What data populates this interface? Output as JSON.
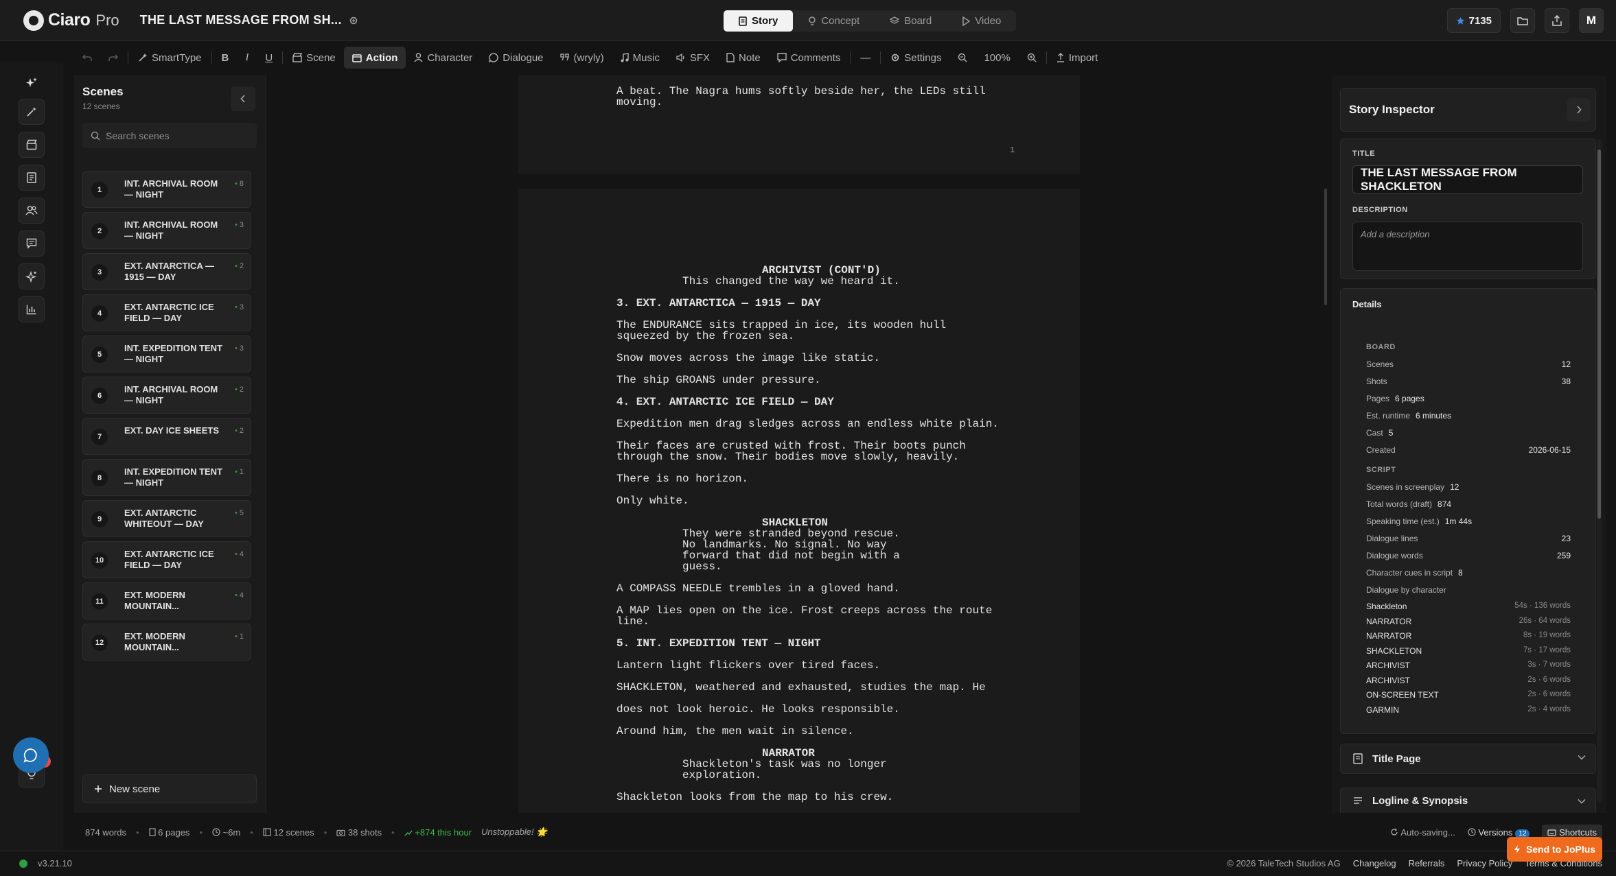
{
  "app": {
    "brand": "Ciaro",
    "brand_suffix": "Pro",
    "doc_title": "THE LAST MESSAGE FROM SH...",
    "modes": [
      {
        "label": "Story",
        "icon": "document-icon"
      },
      {
        "label": "Concept",
        "icon": "bulb-icon"
      },
      {
        "label": "Board",
        "icon": "layers-icon"
      },
      {
        "label": "Video",
        "icon": "play-icon"
      }
    ],
    "active_mode": "Story",
    "credits": "7135",
    "avatar": "M"
  },
  "toolbar": {
    "items": [
      {
        "label": "SmartType",
        "icon": "magic-wand-icon"
      },
      {
        "label": "B",
        "icon": ""
      },
      {
        "label": "I",
        "icon": ""
      },
      {
        "label": "U",
        "icon": ""
      },
      {
        "label": "Scene",
        "icon": "clapper-icon"
      },
      {
        "label": "Action",
        "icon": "action-icon"
      },
      {
        "label": "Character",
        "icon": "person-icon"
      },
      {
        "label": "Dialogue",
        "icon": "bubble-icon"
      },
      {
        "label": "(wryly)",
        "icon": "quote-icon"
      },
      {
        "label": "Music",
        "icon": "music-icon"
      },
      {
        "label": "SFX",
        "icon": "speaker-icon"
      },
      {
        "label": "Note",
        "icon": "note-icon"
      },
      {
        "label": "Comments",
        "icon": "comment-icon"
      },
      {
        "label": "—",
        "icon": ""
      },
      {
        "label": "Settings",
        "icon": "gear-icon"
      },
      {
        "label": "100%",
        "icon": ""
      },
      {
        "label": "Import",
        "icon": "upload-icon"
      }
    ],
    "active": "Action"
  },
  "scenes": {
    "title": "Scenes",
    "count": "12 scenes",
    "search_placeholder": "Search scenes",
    "items": [
      {
        "num": "1",
        "name": "INT. ARCHIVAL ROOM — NIGHT",
        "shots": "8"
      },
      {
        "num": "2",
        "name": "INT. ARCHIVAL ROOM — NIGHT",
        "shots": "3"
      },
      {
        "num": "3",
        "name": "EXT. ANTARCTICA — 1915 — DAY",
        "shots": "2"
      },
      {
        "num": "4",
        "name": "EXT. ANTARCTIC ICE FIELD — DAY",
        "shots": "3"
      },
      {
        "num": "5",
        "name": "INT. EXPEDITION TENT — NIGHT",
        "shots": "3"
      },
      {
        "num": "6",
        "name": "INT. ARCHIVAL ROOM — NIGHT",
        "shots": "2"
      },
      {
        "num": "7",
        "name": "EXT. DAY ICE SHEETS",
        "shots": "2"
      },
      {
        "num": "8",
        "name": "INT. EXPEDITION TENT — NIGHT",
        "shots": "1"
      },
      {
        "num": "9",
        "name": "EXT. ANTARCTIC WHITEOUT — DAY",
        "shots": "5"
      },
      {
        "num": "10",
        "name": "EXT. ANTARCTIC ICE FIELD — DAY",
        "shots": "4"
      },
      {
        "num": "11",
        "name": "EXT. MODERN MOUNTAIN...",
        "shots": "4"
      },
      {
        "num": "12",
        "name": "EXT. MODERN MOUNTAIN...",
        "shots": "1"
      }
    ],
    "new_scene": "New scene"
  },
  "script": {
    "page1": {
      "lines": [
        "A beat. The Nagra hums softly beside her, the LEDs still",
        "moving."
      ],
      "page_number": "1"
    },
    "page2": {
      "cue1": "ARCHIVIST (CONT'D)",
      "dlg1": "This changed the way we heard it.",
      "slug3": "3. EXT. ANTARCTICA — 1915 — DAY",
      "a3_1a": "The ENDURANCE sits trapped in ice, its wooden hull",
      "a3_1b": "squeezed by the frozen sea.",
      "a3_2": "Snow moves across the image like static.",
      "a3_3": "The ship GROANS under pressure.",
      "slug4": "4. EXT. ANTARCTIC ICE FIELD — DAY",
      "a4_1": "Expedition men drag sledges across an endless white plain.",
      "a4_2a": "Their faces are crusted with frost. Their boots punch",
      "a4_2b": "through the snow. Their bodies move slowly, heavily.",
      "a4_3": "There is no horizon.",
      "a4_4": "Only white.",
      "cue2": "SHACKLETON",
      "dlg2a": "They were stranded beyond rescue.",
      "dlg2b": "No landmarks. No signal. No way",
      "dlg2c": "forward that did not begin with a",
      "dlg2d": "guess.",
      "a4_5": "A COMPASS NEEDLE trembles in a gloved hand.",
      "a4_6a": "A MAP lies open on the ice. Frost creeps across the route",
      "a4_6b": "line.",
      "slug5": "5. INT. EXPEDITION TENT — NIGHT",
      "a5_1": "Lantern light flickers over tired faces.",
      "a5_2": "SHACKLETON, weathered and exhausted, studies the map. He",
      "a5_3": "does not look heroic. He looks responsible.",
      "a5_4": "Around him, the men wait in silence.",
      "cue3": "NARRATOR",
      "dlg3a": "Shackleton's task was no longer",
      "dlg3b": "exploration.",
      "a5_5": "Shackleton looks from the map to his crew."
    }
  },
  "inspector": {
    "title": "Story Inspector",
    "title_label": "TITLE",
    "title_value": "THE LAST MESSAGE FROM SHACKLETON",
    "description_label": "DESCRIPTION",
    "description_placeholder": "Add a description",
    "details": {
      "heading": "Details",
      "board_label": "BOARD",
      "scenes_label": "Scenes",
      "scenes": "12",
      "shots_label": "Shots",
      "shots": "38",
      "pages_label": "Pages",
      "pages": "6 pages",
      "runtime_label": "Est. runtime",
      "runtime": "6 minutes",
      "cast_label": "Cast",
      "cast": "5",
      "created_label": "Created",
      "created": "2026-06-15",
      "script_label": "SCRIPT",
      "sis_label": "Scenes in screenplay",
      "sis": "12",
      "words_label": "Total words (draft)",
      "words": "874",
      "speak_label": "Speaking time (est.)",
      "speak": "1m 44s",
      "dlines_label": "Dialogue lines",
      "dlines": "23",
      "dwords_label": "Dialogue words",
      "dwords": "259",
      "cues_label": "Character cues in script",
      "cues": "8",
      "by_char_label": "Dialogue by character",
      "by_char": [
        {
          "name": "Shackleton",
          "meta": "54s · 136 words"
        },
        {
          "name": "NARRATOR",
          "meta": "26s · 64 words"
        },
        {
          "name": "NARRATOR",
          "meta": "8s · 19 words"
        },
        {
          "name": "SHACKLETON",
          "meta": "7s · 17 words"
        },
        {
          "name": "ARCHIVIST",
          "meta": "3s · 7 words"
        },
        {
          "name": "ARCHIVIST",
          "meta": "2s · 6 words"
        },
        {
          "name": "ON-SCREEN TEXT",
          "meta": "2s · 6 words"
        },
        {
          "name": "GARMIN",
          "meta": "2s · 4 words"
        }
      ]
    },
    "title_page": "Title Page",
    "logline": "Logline & Synopsis"
  },
  "status": {
    "words": "874 words",
    "pages": "6 pages",
    "time": "~6m",
    "scenes": "12 scenes",
    "shots": "38 shots",
    "hour": "+874 this hour",
    "badge": "Unstoppable! 🌟",
    "autosave": "Auto-saving...",
    "versions": "Versions",
    "versions_count": "12",
    "shortcuts": "Shortcuts"
  },
  "footer": {
    "version": "v3.21.10",
    "copyright": "© 2026 TaleTech Studios AG",
    "links": [
      "Changelog",
      "Referrals",
      "Privacy Policy",
      "Terms & Conditions"
    ],
    "send_button": "Send to JoPlus"
  },
  "colors": {
    "background": "#141414",
    "accent_blue": "#1f6fb2",
    "accent_orange": "#f06a1d",
    "status_green": "#3fb950",
    "badge_red": "#e5484d"
  }
}
